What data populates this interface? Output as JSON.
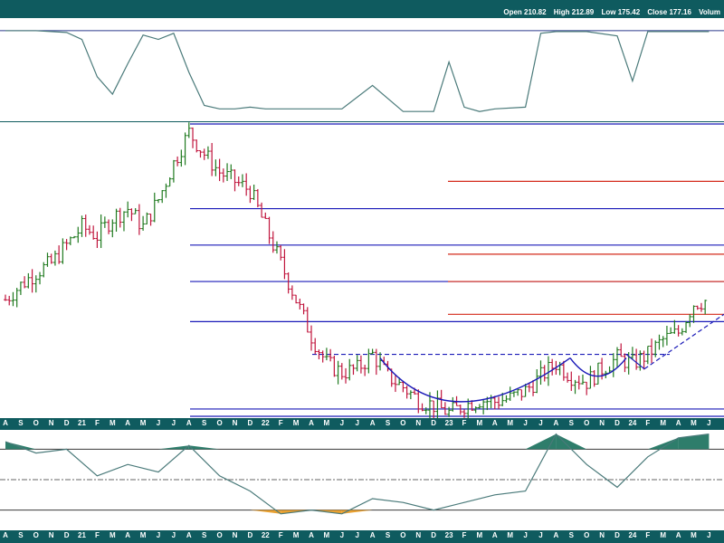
{
  "header": {
    "open_label": "Open",
    "open_value": "210.82",
    "high_label": "High",
    "high_value": "212.89",
    "low_label": "Low",
    "low_value": "175.42",
    "close_label": "Close",
    "close_value": "177.16",
    "volume_label": "Volum"
  },
  "time_axis": [
    "A",
    "S",
    "O",
    "N",
    "D",
    "21",
    "F",
    "M",
    "A",
    "M",
    "J",
    "J",
    "A",
    "S",
    "O",
    "N",
    "D",
    "22",
    "F",
    "M",
    "A",
    "M",
    "J",
    "J",
    "A",
    "S",
    "O",
    "N",
    "D",
    "23",
    "F",
    "M",
    "A",
    "M",
    "J",
    "J",
    "A",
    "S",
    "O",
    "N",
    "D",
    "24",
    "F",
    "M",
    "A",
    "M",
    "J"
  ],
  "colors": {
    "frame": "#0f5b5f",
    "up_bar": "#1f7a1f",
    "down_bar": "#c0143c",
    "support_line": "#1a1ab8",
    "resistance_line": "#d42a1a",
    "indicator_line": "#4a7a7a",
    "indicator_fill_top": "#2e7d6b",
    "indicator_fill_bottom": "#e8a030"
  },
  "chart_data": [
    {
      "type": "line",
      "panel": "upper-indicator",
      "x": [
        "2020-08",
        "2020-10",
        "2020-12",
        "2021-01",
        "2021-02",
        "2021-03",
        "2021-04",
        "2021-05",
        "2021-06",
        "2021-07",
        "2021-08",
        "2021-09",
        "2021-10",
        "2021-11",
        "2021-12",
        "2022-01",
        "2022-02",
        "2022-04",
        "2022-06",
        "2022-08",
        "2022-10",
        "2022-12",
        "2023-01",
        "2023-02",
        "2023-03",
        "2023-04",
        "2023-06",
        "2023-07",
        "2023-08",
        "2023-10",
        "2023-12",
        "2024-01",
        "2024-02",
        "2024-04",
        "2024-06"
      ],
      "values": [
        0.98,
        0.98,
        0.96,
        0.88,
        0.45,
        0.25,
        0.6,
        0.93,
        0.88,
        0.95,
        0.5,
        0.12,
        0.08,
        0.08,
        0.1,
        0.08,
        0.08,
        0.08,
        0.08,
        0.35,
        0.05,
        0.05,
        0.62,
        0.1,
        0.05,
        0.08,
        0.1,
        0.95,
        0.97,
        0.97,
        0.92,
        0.4,
        0.97,
        0.97,
        0.97
      ],
      "guide_level": 0.98
    },
    {
      "type": "bar",
      "subtype": "ohlc",
      "panel": "price",
      "x": [
        "2020-08",
        "2020-09",
        "2020-10",
        "2020-11",
        "2020-12",
        "2021-01",
        "2021-02",
        "2021-03",
        "2021-04",
        "2021-05",
        "2021-06",
        "2021-07",
        "2021-08",
        "2021-09",
        "2021-10",
        "2021-11",
        "2021-12",
        "2022-01",
        "2022-02",
        "2022-03",
        "2022-04",
        "2022-05",
        "2022-06",
        "2022-07",
        "2022-08",
        "2022-09",
        "2022-10",
        "2022-11",
        "2022-12",
        "2023-01",
        "2023-02",
        "2023-03",
        "2023-04",
        "2023-05",
        "2023-06",
        "2023-07",
        "2023-08",
        "2023-09",
        "2023-10",
        "2023-11",
        "2023-12",
        "2024-01",
        "2024-02",
        "2024-03",
        "2024-04",
        "2024-05",
        "2024-06"
      ],
      "close": [
        120,
        128,
        135,
        140,
        150,
        160,
        155,
        165,
        170,
        160,
        175,
        195,
        212,
        200,
        190,
        185,
        180,
        160,
        140,
        120,
        100,
        85,
        80,
        82,
        90,
        78,
        72,
        65,
        62,
        58,
        62,
        65,
        64,
        66,
        70,
        78,
        85,
        78,
        75,
        82,
        88,
        85,
        90,
        98,
        102,
        118,
        120
      ],
      "levels": {
        "support_blue": [
          170,
          150,
          130,
          108,
          60
        ],
        "resistance_red": [
          185,
          145,
          130,
          112
        ],
        "neckline": 90
      }
    },
    {
      "type": "area",
      "panel": "lower-oscillator",
      "x": [
        "2020-08",
        "2020-10",
        "2020-12",
        "2021-02",
        "2021-04",
        "2021-06",
        "2021-08",
        "2021-10",
        "2021-12",
        "2022-02",
        "2022-04",
        "2022-06",
        "2022-08",
        "2022-10",
        "2022-12",
        "2023-02",
        "2023-04",
        "2023-06",
        "2023-08",
        "2023-10",
        "2023-12",
        "2024-02",
        "2024-04",
        "2024-06"
      ],
      "values": [
        1.0,
        0.7,
        0.8,
        0.1,
        0.4,
        0.2,
        0.9,
        0.1,
        -0.3,
        -0.9,
        -0.8,
        -0.9,
        -0.5,
        -0.6,
        -0.8,
        -0.6,
        -0.4,
        -0.3,
        1.2,
        0.4,
        -0.2,
        0.6,
        1.1,
        1.2
      ],
      "upper_level": 0.8,
      "lower_level": -0.8
    }
  ]
}
